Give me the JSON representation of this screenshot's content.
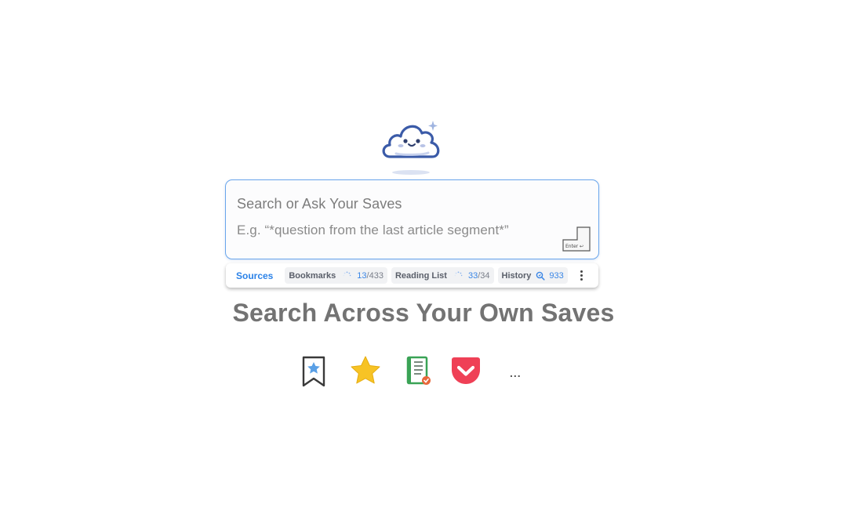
{
  "search": {
    "placeholder": "Search or Ask Your Saves",
    "example": "E.g. “*question from the last article segment*”",
    "enter_key_label": "Enter ↩"
  },
  "sources_bar": {
    "title": "Sources",
    "bookmarks": {
      "name": "Bookmarks",
      "done": "13",
      "total": "/433"
    },
    "reading_list": {
      "name": "Reading List",
      "done": "33",
      "total": "/34"
    },
    "history": {
      "name": "History",
      "count": "933"
    },
    "more_icon": "vertical-ellipsis"
  },
  "headline": "Search Across Your Own Saves",
  "source_icons": [
    {
      "name": "bookmark-star-icon"
    },
    {
      "name": "star-icon"
    },
    {
      "name": "reading-list-icon"
    },
    {
      "name": "pocket-icon"
    }
  ],
  "more_sources": "...",
  "colors": {
    "accent": "#2b82e8",
    "logo": "#3b5ba8",
    "headline": "#737373",
    "pocket": "#ef4056",
    "star": "#f7c325",
    "reading_list": "#3aa356"
  }
}
